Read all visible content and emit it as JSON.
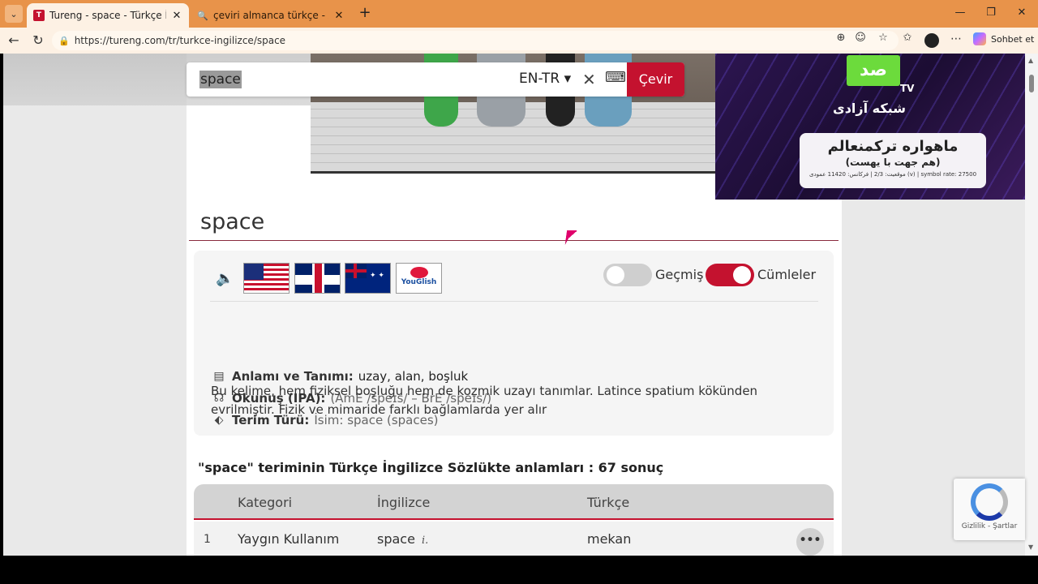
{
  "browser": {
    "tabs": [
      {
        "title": "Tureng - space - Türkçe İngilizce Sözlük",
        "active": true
      },
      {
        "title": "çeviri almanca türkçe - Arama",
        "active": false
      }
    ],
    "url": "https://tureng.com/tr/turkce-ingilizce/space",
    "copilot_label": "Sohbet et"
  },
  "search": {
    "query": "space",
    "lang": "EN-TR ▾",
    "submit": "Çevir"
  },
  "ad": {
    "logo": "صد",
    "tv": "TV",
    "line1": "شبکه آزادی",
    "box_title": "ماهواره ترکمنعالم",
    "box_sub": "(هم جهت با یهست)",
    "box_small": "موقعیت: 2/3 | فرکانس: 11420 عمودی (v) | symbol rate: 27500"
  },
  "word": {
    "title": "space",
    "toggles": {
      "history": "Geçmiş",
      "sentences": "Cümleler"
    },
    "youglish": "YouGlish",
    "meaning_label": "Anlamı ve Tanımı:",
    "meaning_value": "uzay, alan, boşluk",
    "ipa_label": "Okunuş (IPA):",
    "ipa_value": "(AmE /speɪs/ – BrE /speɪs/)",
    "type_label": "Terim Türü:",
    "type_value": "İsim: space (spaces)",
    "description": "Bu kelime, hem fiziksel boşluğu hem de kozmik uzayı tanımlar. Latince spatium kökünden evrilmiştir. Fizik ve mimaride farklı bağlamlarda yer alır"
  },
  "results": {
    "heading": "\"space\" teriminin Türkçe İngilizce Sözlükte anlamları : 67 sonuç",
    "headers": [
      "Kategori",
      "İngilizce",
      "Türkçe"
    ],
    "rows": [
      {
        "num": "1",
        "category": "Yaygın Kullanım",
        "english": "space",
        "abbr": "i.",
        "turkish": "mekan"
      }
    ]
  },
  "recaptcha": {
    "text": "Gizlilik - Şartlar"
  }
}
